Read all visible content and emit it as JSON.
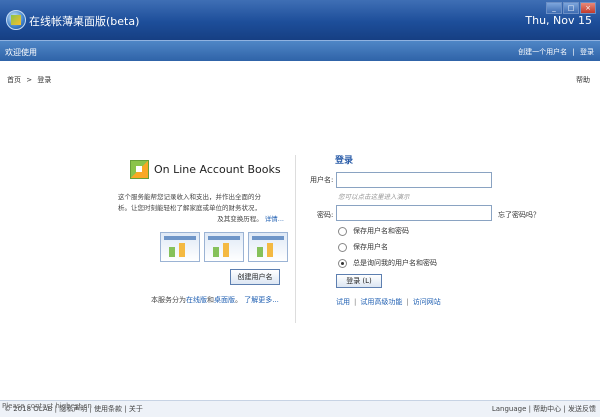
{
  "window": {
    "title": "在线帐薄桌面版(beta)",
    "date": "Thu, Nov 15",
    "buttons": [
      "_",
      "□",
      "×"
    ]
  },
  "navbar": {
    "welcome": "欢迎使用",
    "create_user": "创建一个用户名",
    "separator": "|",
    "login": "登录"
  },
  "breadcrumb": {
    "home": "首页",
    "sep": ">",
    "current": "登录"
  },
  "help": "帮助",
  "intro": {
    "brand": "On Line Account Books",
    "desc_line1": "这个服务能帮您记录收入和支出，并作出全面的分",
    "desc_line2": "析。让您时刻能轻松了解家庭或单位的财务状况，",
    "desc_line3": "及其变换历程。",
    "desc_link": "详情...",
    "create_button": "创建用户名",
    "service_prefix": "本服务分为",
    "service_online": "在线版",
    "service_and": "和",
    "service_desktop": "桌面版",
    "service_dot": "。",
    "service_more": "了解更多..."
  },
  "login": {
    "title": "登录",
    "username_label": "用户名:",
    "username_hint": "您可以点击这里进入演示",
    "password_label": "密码:",
    "forgot": "忘了密码吗？",
    "options": [
      "保存用户名和密码",
      "保存用户名",
      "总是询问我的用户名和密码"
    ],
    "selected_option": 2,
    "submit": "登录 (L)",
    "links": [
      "试用",
      "试用高级功能",
      "访问网站"
    ],
    "link_sep": "|"
  },
  "footer": {
    "left": "© 2018 OLAB | 隐私声明 | 使用条款 | 关于",
    "right": "Language | 帮助中心 | 发送反馈",
    "watermark": "Please contact highest.cn"
  },
  "colors": {
    "title_bg": "#1d4e9a",
    "nav_bg": "#3a6fb4",
    "link": "#1f5fb2"
  }
}
